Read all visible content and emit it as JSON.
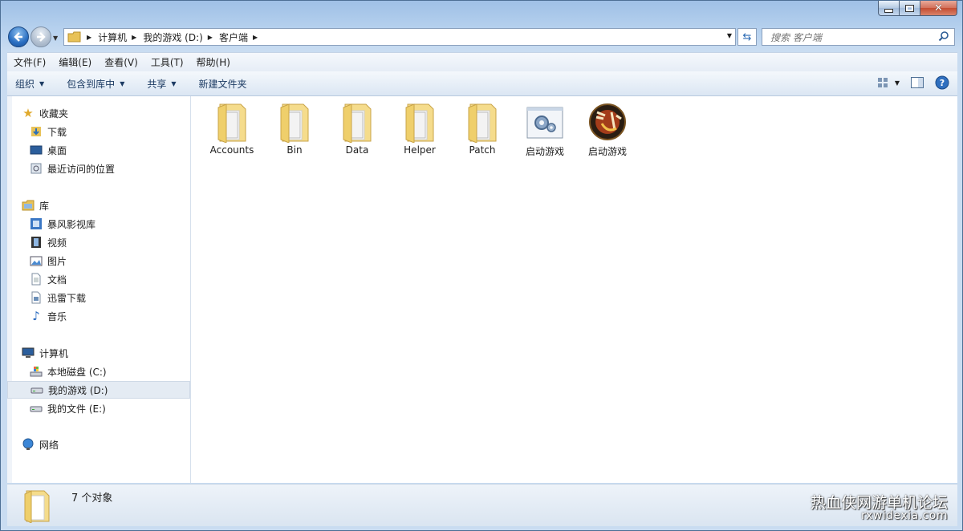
{
  "window": {
    "caption_buttons": [
      "minimize",
      "maximize",
      "close"
    ]
  },
  "address_bar": {
    "breadcrumbs": [
      "计算机",
      "我的游戏 (D:)",
      "客户端"
    ]
  },
  "search": {
    "placeholder": "搜索 客户端"
  },
  "menu": [
    "文件(F)",
    "编辑(E)",
    "查看(V)",
    "工具(T)",
    "帮助(H)"
  ],
  "commands": {
    "organize": "组织",
    "include_library": "包含到库中",
    "share": "共享",
    "new_folder": "新建文件夹"
  },
  "sidebar": {
    "favorites": {
      "label": "收藏夹",
      "items": [
        "下载",
        "桌面",
        "最近访问的位置"
      ]
    },
    "libraries": {
      "label": "库",
      "items": [
        "暴风影视库",
        "视频",
        "图片",
        "文档",
        "迅雷下载",
        "音乐"
      ]
    },
    "computer": {
      "label": "计算机",
      "items": [
        "本地磁盘 (C:)",
        "我的游戏 (D:)",
        "我的文件 (E:)"
      ],
      "selected": "我的游戏 (D:)"
    },
    "network": {
      "label": "网络"
    }
  },
  "files": [
    {
      "name": "Accounts",
      "type": "folder"
    },
    {
      "name": "Bin",
      "type": "folder"
    },
    {
      "name": "Data",
      "type": "folder"
    },
    {
      "name": "Helper",
      "type": "folder"
    },
    {
      "name": "Patch",
      "type": "folder"
    },
    {
      "name": "启动游戏",
      "type": "settings-app"
    },
    {
      "name": "启动游戏",
      "type": "game-app"
    }
  ],
  "status": {
    "count_text": "7 个对象"
  },
  "watermark": {
    "line1": "热血侠网游单机论坛",
    "line2": "rxwidexia.com"
  },
  "colors": {
    "selection": "#e4ebf3",
    "chrome": "#c9dcf1",
    "folder": "#f3d77a"
  }
}
